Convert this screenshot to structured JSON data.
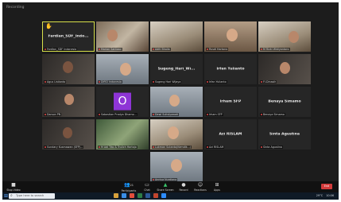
{
  "window": {
    "recording_label": "Recording"
  },
  "tiles": [
    {
      "name": "Fardlan_SDF_Indo...",
      "label": "Fardlan_SDF Indonesia",
      "active": true,
      "hand_raised": true,
      "video": false
    },
    {
      "name": "",
      "label": "Marlan Santoso",
      "video": true
    },
    {
      "name": "",
      "label": "Aditi Bhalla",
      "video": true
    },
    {
      "name": "",
      "label": "Rusdi Hartono",
      "video": true
    },
    {
      "name": "",
      "label": "M Rizki Widiyantoro",
      "video": true
    },
    {
      "name": "",
      "label": "Agus Listianto",
      "video": true
    },
    {
      "name": "",
      "label": "DIFID Indonesia",
      "video": true
    },
    {
      "name": "Sugeng_Hari_Wi...",
      "label": "Sugeng Hari Wijaya",
      "video": false
    },
    {
      "name": "Irfan Yulianto",
      "label": "Irfan Yulianto",
      "video": false
    },
    {
      "name": "",
      "label": "FI-Dinasih",
      "video": true
    },
    {
      "name": "",
      "label": "Darson PN",
      "video": true
    },
    {
      "name": "",
      "label": "Sabastian Pradya Dhamo...",
      "video": false,
      "avatar": "O"
    },
    {
      "name": "",
      "label": "Dewi Sulistyawati",
      "video": true
    },
    {
      "name": "Irham SFP",
      "label": "Irham SFP",
      "video": false
    },
    {
      "name": "Benaya Simamo",
      "label": "Benaya Simamo",
      "video": false
    },
    {
      "name": "",
      "label": "Sundary Kusmawan (SFP)...",
      "video": true
    },
    {
      "name": "",
      "label": "M Adi Tito & Trulich Hartojo",
      "video": true
    },
    {
      "name": "",
      "label": "Lukman Sutanto(Kemdik...)",
      "video": true
    },
    {
      "name": "Azi RISLAM",
      "label": "Azi RISLAM",
      "video": false
    },
    {
      "name": "Sinta Agustina",
      "label": "Sinta Agustina",
      "video": false
    },
    {
      "name": "",
      "label": "Annisa Nurdiana",
      "video": true
    }
  ],
  "toolbar": {
    "stop_video": "Stop Video",
    "participants": "Participants",
    "participants_count": "21",
    "chat": "Chat",
    "share_screen": "Share Screen",
    "record": "Record",
    "reactions": "Reactions",
    "apps": "Apps",
    "end": "End"
  },
  "taskbar": {
    "search_placeholder": "Type here to search",
    "weather": "29°C",
    "time": "10:06"
  }
}
